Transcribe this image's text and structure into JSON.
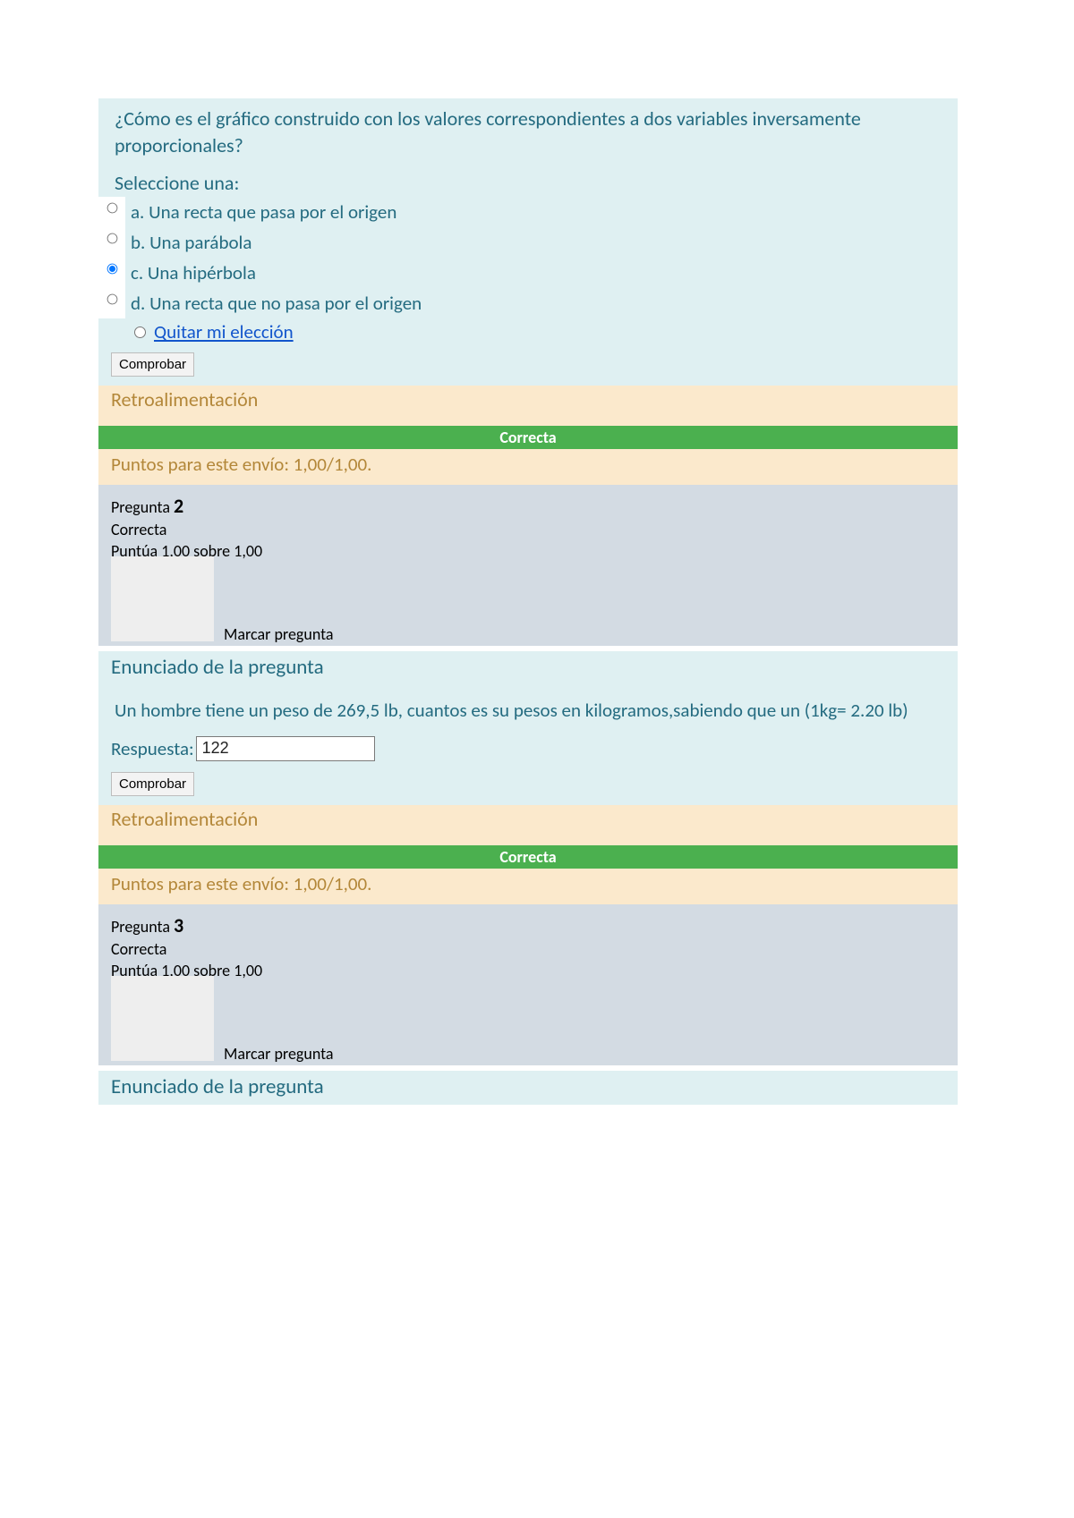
{
  "q1": {
    "text": "¿Cómo es el gráfico construido con los valores correspondientes a dos variables inversamente proporcionales?",
    "select_one": "Seleccione una:",
    "options": {
      "a": "a. Una recta que pasa por el origen",
      "b": "b. Una parábola",
      "c": "c. Una hipérbola",
      "d": "d. Una recta que no pasa por el origen"
    },
    "clear_choice": "Quitar mi elección",
    "check": "Comprobar",
    "feedback_heading": "Retroalimentación",
    "correct_label": "Correcta",
    "points": "Puntos para este envío: 1,00/1,00."
  },
  "q2": {
    "number_prefix": "Pregunta ",
    "number": "2",
    "state": "Correcta",
    "grade": "Puntúa 1,00 sobre 1,00",
    "flag_label": "Marcar pregunta",
    "stem_heading": "Enunciado de la pregunta",
    "stem": "Un  hombre tiene un peso de 269,5 lb,  cuantos es su pesos en kilogramos,sabiendo que un (1kg= 2.20 lb)",
    "answer_label": "Respuesta:",
    "answer_value": "122",
    "check": "Comprobar",
    "feedback_heading": "Retroalimentación",
    "correct_label": "Correcta",
    "points": "Puntos para este envío: 1,00/1,00."
  },
  "q3": {
    "number_prefix": "Pregunta ",
    "number": "3",
    "state": "Correcta",
    "grade": "Puntúa 1,00 sobre 1,00",
    "flag_label": "Marcar pregunta",
    "stem_heading": "Enunciado de la pregunta"
  }
}
